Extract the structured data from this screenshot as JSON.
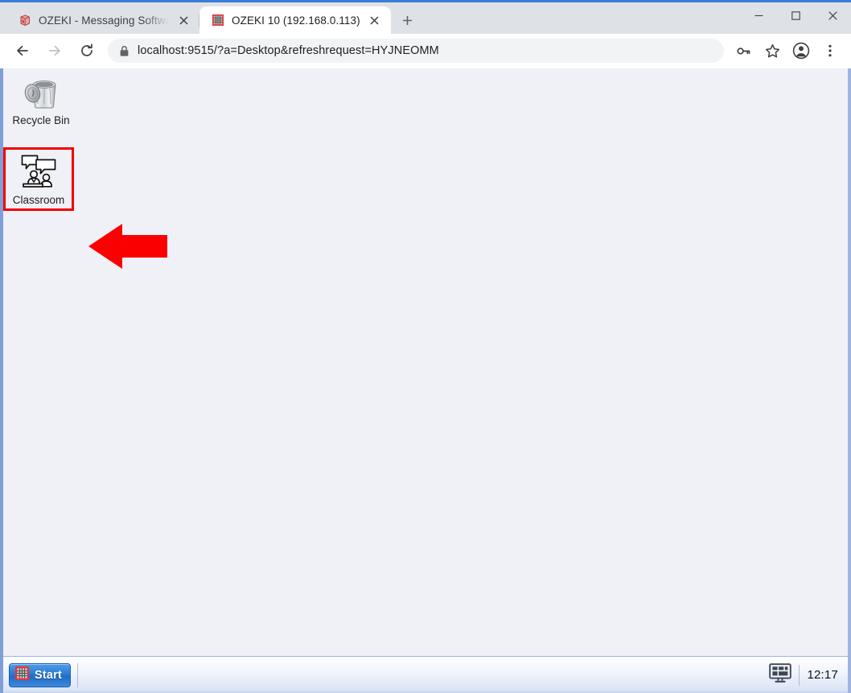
{
  "browser": {
    "tabs": [
      {
        "title": "OZEKI - Messaging Software Pro",
        "favicon": "ozeki-box-icon",
        "active": false,
        "close_label": "×"
      },
      {
        "title": "OZEKI 10 (192.168.0.113)",
        "favicon": "ozeki-grid-icon",
        "active": true,
        "close_label": "×"
      }
    ],
    "new_tab_label": "+",
    "window_controls": {
      "minimize": "minimize-button",
      "maximize": "maximize-button",
      "close": "close-button"
    },
    "toolbar": {
      "back": "back-button",
      "forward": "forward-button",
      "reload": "reload-button",
      "url": "localhost:9515/?a=Desktop&refreshrequest=HYJNEOMM",
      "url_host": "localhost",
      "url_rest": ":9515/?a=Desktop&refreshrequest=HYJNEOMM",
      "lock": "site-security-lock-icon",
      "password_key": "password-key-icon",
      "bookmark": "bookmark-star-icon",
      "profile": "profile-avatar-icon",
      "menu": "browser-menu-icon"
    }
  },
  "desktop": {
    "background_color": "#f0f0f7",
    "icons": [
      {
        "id": "recycle-bin",
        "label": "Recycle Bin",
        "icon": "recycle-bin-icon",
        "highlighted": false
      },
      {
        "id": "classroom",
        "label": "Classroom",
        "icon": "classroom-icon",
        "highlighted": true,
        "highlight_color": "#f00000"
      }
    ],
    "annotation": {
      "type": "arrow",
      "direction": "left",
      "color": "#fa0000",
      "points_to": "classroom"
    }
  },
  "taskbar": {
    "start_label": "Start",
    "start_icon": "ozeki-grid-icon",
    "tray": {
      "display_icon": "monitor-icon",
      "clock": "12:17"
    }
  }
}
